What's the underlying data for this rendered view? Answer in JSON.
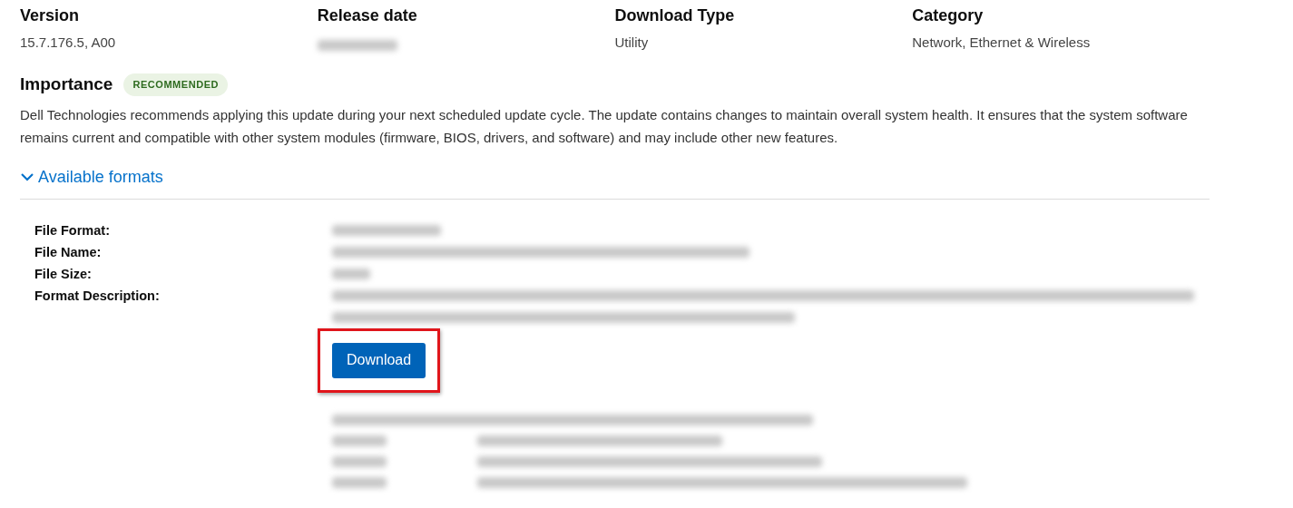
{
  "summary": [
    {
      "label": "Version",
      "value": "15.7.176.5, A00",
      "redacted": false
    },
    {
      "label": "Release date",
      "redacted": true
    },
    {
      "label": "Download Type",
      "value": "Utility",
      "redacted": false
    },
    {
      "label": "Category",
      "value": "Network, Ethernet & Wireless",
      "redacted": false
    }
  ],
  "importance": {
    "label": "Importance",
    "badge": "RECOMMENDED",
    "description": "Dell Technologies recommends applying this update during your next scheduled update cycle. The update contains changes to maintain overall system health. It ensures that the system software remains current and compatible with other system modules (firmware, BIOS, drivers, and software) and may include other new features."
  },
  "formats": {
    "toggle": "Available formats",
    "expanded": true,
    "fields": [
      {
        "label": "File Format:",
        "redacted": true
      },
      {
        "label": "File Name:",
        "redacted": true
      },
      {
        "label": "File Size:",
        "redacted": true
      },
      {
        "label": "Format Description:",
        "redacted": true
      }
    ],
    "button": "Download",
    "highlighted": true,
    "checksums_redacted": true
  }
}
